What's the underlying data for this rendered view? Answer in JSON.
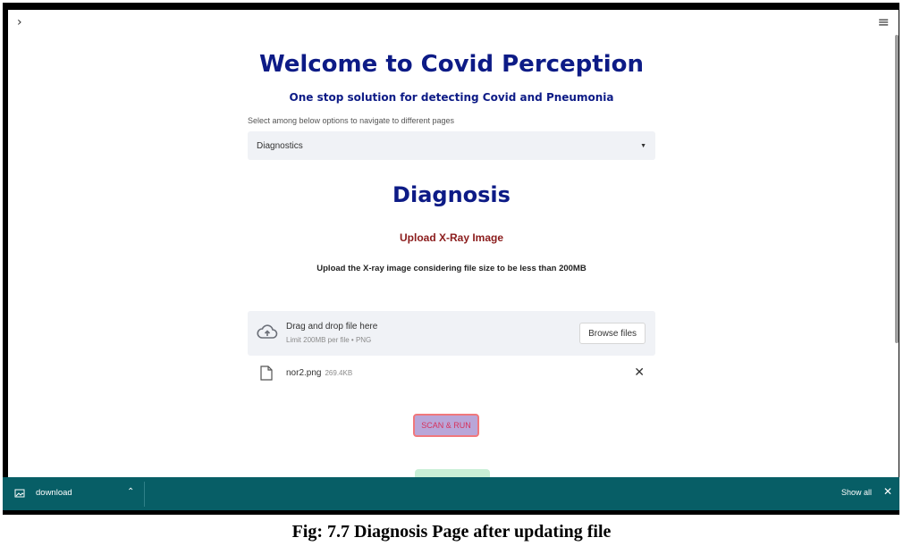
{
  "header": {
    "sidebar_toggle_icon": "chevron-right-icon",
    "menu_icon": "hamburger-menu-icon"
  },
  "page": {
    "title": "Welcome to Covid Perception",
    "subtitle": "One stop solution for detecting Covid and Pneumonia",
    "nav_label": "Select among below options to navigate to different pages",
    "nav_selected": "Diagnostics"
  },
  "diagnosis": {
    "title": "Diagnosis",
    "upload_heading": "Upload X-Ray Image",
    "instruction": "Upload the X-ray image considering file size to be less than 200MB"
  },
  "uploader": {
    "drop_text": "Drag and drop file here",
    "limit_text": "Limit 200MB per file • PNG",
    "browse_label": "Browse files",
    "file_name": "nor2.png",
    "file_size": "269.4KB"
  },
  "actions": {
    "scan_label": "SCAN & RUN"
  },
  "downloads": {
    "file_label": "download",
    "show_all": "Show all"
  },
  "caption": "Fig: 7.7 Diagnosis Page after updating file",
  "colors": {
    "title_navy": "#0d1b86",
    "heading_maroon": "#8b1c1c",
    "downloads_bar": "#075e66",
    "scan_button_bg": "#b9a6d8",
    "scan_button_border": "#f0787c"
  }
}
